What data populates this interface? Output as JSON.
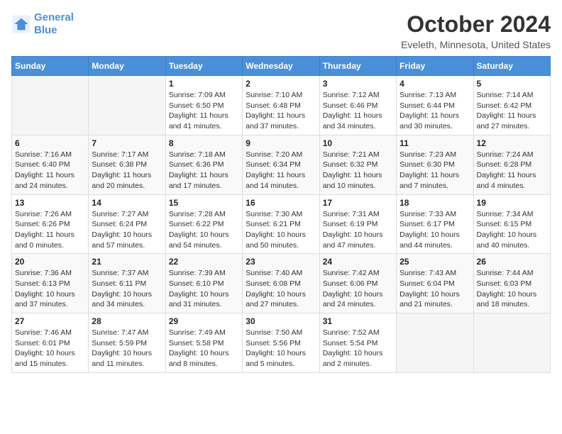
{
  "logo": {
    "line1": "General",
    "line2": "Blue"
  },
  "title": "October 2024",
  "subtitle": "Eveleth, Minnesota, United States",
  "days_of_week": [
    "Sunday",
    "Monday",
    "Tuesday",
    "Wednesday",
    "Thursday",
    "Friday",
    "Saturday"
  ],
  "weeks": [
    [
      {
        "day": "",
        "sunrise": "",
        "sunset": "",
        "daylight": ""
      },
      {
        "day": "",
        "sunrise": "",
        "sunset": "",
        "daylight": ""
      },
      {
        "day": "1",
        "sunrise": "Sunrise: 7:09 AM",
        "sunset": "Sunset: 6:50 PM",
        "daylight": "Daylight: 11 hours and 41 minutes."
      },
      {
        "day": "2",
        "sunrise": "Sunrise: 7:10 AM",
        "sunset": "Sunset: 6:48 PM",
        "daylight": "Daylight: 11 hours and 37 minutes."
      },
      {
        "day": "3",
        "sunrise": "Sunrise: 7:12 AM",
        "sunset": "Sunset: 6:46 PM",
        "daylight": "Daylight: 11 hours and 34 minutes."
      },
      {
        "day": "4",
        "sunrise": "Sunrise: 7:13 AM",
        "sunset": "Sunset: 6:44 PM",
        "daylight": "Daylight: 11 hours and 30 minutes."
      },
      {
        "day": "5",
        "sunrise": "Sunrise: 7:14 AM",
        "sunset": "Sunset: 6:42 PM",
        "daylight": "Daylight: 11 hours and 27 minutes."
      }
    ],
    [
      {
        "day": "6",
        "sunrise": "Sunrise: 7:16 AM",
        "sunset": "Sunset: 6:40 PM",
        "daylight": "Daylight: 11 hours and 24 minutes."
      },
      {
        "day": "7",
        "sunrise": "Sunrise: 7:17 AM",
        "sunset": "Sunset: 6:38 PM",
        "daylight": "Daylight: 11 hours and 20 minutes."
      },
      {
        "day": "8",
        "sunrise": "Sunrise: 7:18 AM",
        "sunset": "Sunset: 6:36 PM",
        "daylight": "Daylight: 11 hours and 17 minutes."
      },
      {
        "day": "9",
        "sunrise": "Sunrise: 7:20 AM",
        "sunset": "Sunset: 6:34 PM",
        "daylight": "Daylight: 11 hours and 14 minutes."
      },
      {
        "day": "10",
        "sunrise": "Sunrise: 7:21 AM",
        "sunset": "Sunset: 6:32 PM",
        "daylight": "Daylight: 11 hours and 10 minutes."
      },
      {
        "day": "11",
        "sunrise": "Sunrise: 7:23 AM",
        "sunset": "Sunset: 6:30 PM",
        "daylight": "Daylight: 11 hours and 7 minutes."
      },
      {
        "day": "12",
        "sunrise": "Sunrise: 7:24 AM",
        "sunset": "Sunset: 6:28 PM",
        "daylight": "Daylight: 11 hours and 4 minutes."
      }
    ],
    [
      {
        "day": "13",
        "sunrise": "Sunrise: 7:26 AM",
        "sunset": "Sunset: 6:26 PM",
        "daylight": "Daylight: 11 hours and 0 minutes."
      },
      {
        "day": "14",
        "sunrise": "Sunrise: 7:27 AM",
        "sunset": "Sunset: 6:24 PM",
        "daylight": "Daylight: 10 hours and 57 minutes."
      },
      {
        "day": "15",
        "sunrise": "Sunrise: 7:28 AM",
        "sunset": "Sunset: 6:22 PM",
        "daylight": "Daylight: 10 hours and 54 minutes."
      },
      {
        "day": "16",
        "sunrise": "Sunrise: 7:30 AM",
        "sunset": "Sunset: 6:21 PM",
        "daylight": "Daylight: 10 hours and 50 minutes."
      },
      {
        "day": "17",
        "sunrise": "Sunrise: 7:31 AM",
        "sunset": "Sunset: 6:19 PM",
        "daylight": "Daylight: 10 hours and 47 minutes."
      },
      {
        "day": "18",
        "sunrise": "Sunrise: 7:33 AM",
        "sunset": "Sunset: 6:17 PM",
        "daylight": "Daylight: 10 hours and 44 minutes."
      },
      {
        "day": "19",
        "sunrise": "Sunrise: 7:34 AM",
        "sunset": "Sunset: 6:15 PM",
        "daylight": "Daylight: 10 hours and 40 minutes."
      }
    ],
    [
      {
        "day": "20",
        "sunrise": "Sunrise: 7:36 AM",
        "sunset": "Sunset: 6:13 PM",
        "daylight": "Daylight: 10 hours and 37 minutes."
      },
      {
        "day": "21",
        "sunrise": "Sunrise: 7:37 AM",
        "sunset": "Sunset: 6:11 PM",
        "daylight": "Daylight: 10 hours and 34 minutes."
      },
      {
        "day": "22",
        "sunrise": "Sunrise: 7:39 AM",
        "sunset": "Sunset: 6:10 PM",
        "daylight": "Daylight: 10 hours and 31 minutes."
      },
      {
        "day": "23",
        "sunrise": "Sunrise: 7:40 AM",
        "sunset": "Sunset: 6:08 PM",
        "daylight": "Daylight: 10 hours and 27 minutes."
      },
      {
        "day": "24",
        "sunrise": "Sunrise: 7:42 AM",
        "sunset": "Sunset: 6:06 PM",
        "daylight": "Daylight: 10 hours and 24 minutes."
      },
      {
        "day": "25",
        "sunrise": "Sunrise: 7:43 AM",
        "sunset": "Sunset: 6:04 PM",
        "daylight": "Daylight: 10 hours and 21 minutes."
      },
      {
        "day": "26",
        "sunrise": "Sunrise: 7:44 AM",
        "sunset": "Sunset: 6:03 PM",
        "daylight": "Daylight: 10 hours and 18 minutes."
      }
    ],
    [
      {
        "day": "27",
        "sunrise": "Sunrise: 7:46 AM",
        "sunset": "Sunset: 6:01 PM",
        "daylight": "Daylight: 10 hours and 15 minutes."
      },
      {
        "day": "28",
        "sunrise": "Sunrise: 7:47 AM",
        "sunset": "Sunset: 5:59 PM",
        "daylight": "Daylight: 10 hours and 11 minutes."
      },
      {
        "day": "29",
        "sunrise": "Sunrise: 7:49 AM",
        "sunset": "Sunset: 5:58 PM",
        "daylight": "Daylight: 10 hours and 8 minutes."
      },
      {
        "day": "30",
        "sunrise": "Sunrise: 7:50 AM",
        "sunset": "Sunset: 5:56 PM",
        "daylight": "Daylight: 10 hours and 5 minutes."
      },
      {
        "day": "31",
        "sunrise": "Sunrise: 7:52 AM",
        "sunset": "Sunset: 5:54 PM",
        "daylight": "Daylight: 10 hours and 2 minutes."
      },
      {
        "day": "",
        "sunrise": "",
        "sunset": "",
        "daylight": ""
      },
      {
        "day": "",
        "sunrise": "",
        "sunset": "",
        "daylight": ""
      }
    ]
  ]
}
